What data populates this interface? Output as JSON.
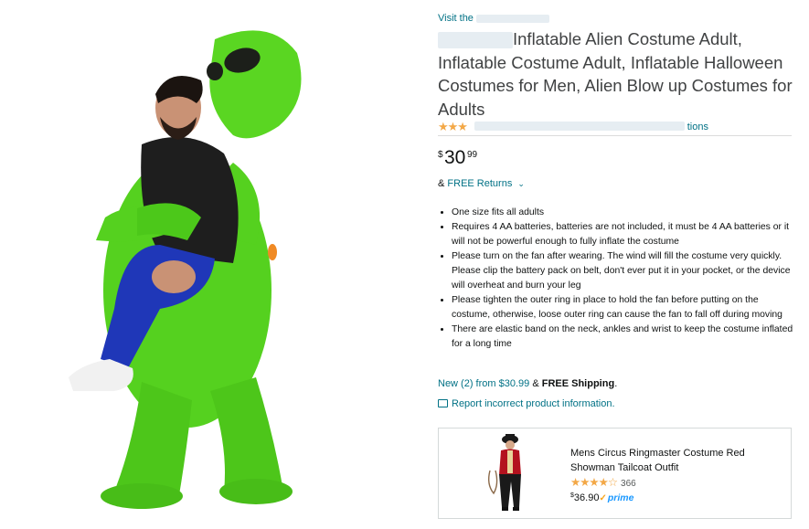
{
  "product": {
    "store_link": "Visit the",
    "title": "Inflatable Alien Costume Adult, Inflatable Costume Adult, Inflatable Halloween Costumes for Men, Alien Blow up Costumes for Adults",
    "title_redacted_prefix": "",
    "rating_stars": "★★★",
    "ratings_suffix": "tions",
    "price": {
      "symbol": "$",
      "whole": "30",
      "fraction": "99"
    },
    "returns": {
      "prefix": "&",
      "link": "FREE Returns",
      "chevron": "⌄"
    },
    "bullets": [
      "One size fits all adults",
      "Requires 4 AA batteries, batteries are not included, it must be 4 AA batteries or it will not be powerful enough to fully inflate the costume",
      "Please turn on the fan after wearing. The wind will fill the costume very quickly. Please clip the battery pack on belt, don't ever put it in your pocket, or the device will overheat and burn your leg",
      "Please tighten the outer ring in place to hold the fan before putting on the costume, otherwise, loose outer ring can cause the fan to fall off during moving",
      "There are elastic band on the neck, ankles and wrist to keep the costume inflated for a long time"
    ],
    "new_offers": {
      "link": "New (2) from $30.99",
      "amp": "&",
      "shipping": "FREE Shipping",
      "period": "."
    },
    "report_link": "Report incorrect product information."
  },
  "ad": {
    "title": "Mens Circus Ringmaster Costume Red Showman Tailcoat Outfit",
    "stars": "★★★★☆",
    "review_count": "366",
    "price_symbol": "$",
    "price_value": "36.90",
    "prime_check": "✓",
    "prime_label": "prime"
  },
  "colors": {
    "link": "#007185",
    "star": "#f3a847",
    "prime": "#1a98ff",
    "costume_green": "#55d11f"
  }
}
